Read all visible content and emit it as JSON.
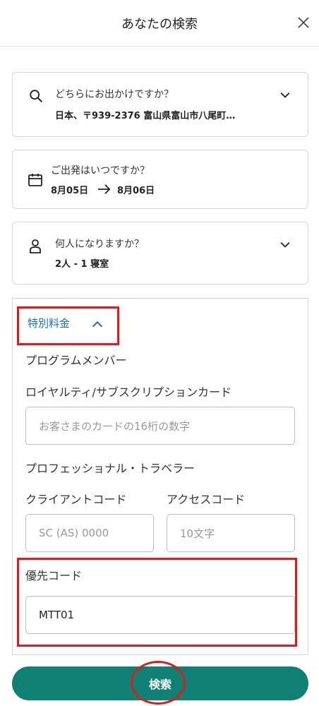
{
  "header": {
    "title": "あなたの検索"
  },
  "destination": {
    "question": "どちらにお出かけですか？",
    "value": "日本、〒939-2376 富山県富山市八尾町…"
  },
  "dates": {
    "question": "ご出発はいつですか？",
    "checkin": "8月05日",
    "checkout": "8月06日"
  },
  "guests": {
    "question": "何人になりますか？",
    "value": "2人 - 1 寝室"
  },
  "special_rates": {
    "toggle_label": "特別料金",
    "program_heading": "プログラムメンバー",
    "loyalty_label": "ロイヤルティ/サブスクリプションカード",
    "loyalty_placeholder": "お客さまのカードの16桁の数字",
    "travel_pro_heading": "プロフェッショナル・トラベラー",
    "client_code_label": "クライアントコード",
    "client_code_placeholder": "SC (AS) 0000",
    "access_code_label": "アクセスコード",
    "access_code_placeholder": "10文字",
    "priority_code_label": "優先コード",
    "priority_code_value": "MTT01"
  },
  "search_button": {
    "label": "検索"
  },
  "colors": {
    "accent": "#0e8074",
    "link": "#1b6ec2",
    "highlight": "#d81e1e"
  },
  "icons": [
    "close-icon",
    "search-icon",
    "chevron-down-icon",
    "calendar-icon",
    "arrow-right-icon",
    "person-icon",
    "chevron-up-icon"
  ]
}
